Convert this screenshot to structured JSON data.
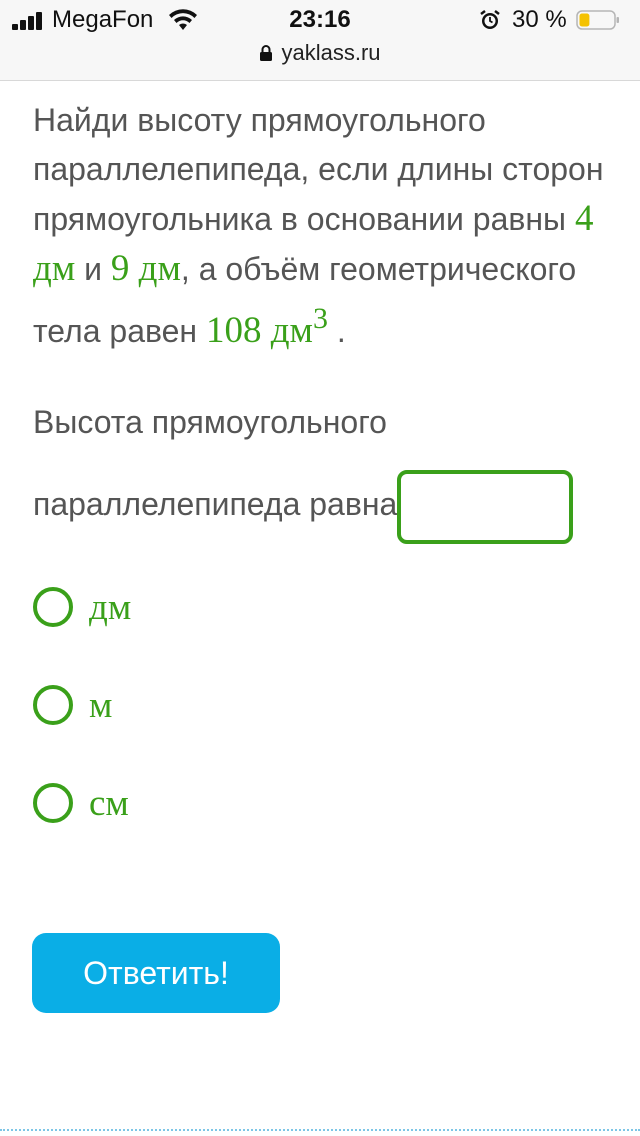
{
  "status_bar": {
    "carrier": "MegaFon",
    "time": "23:16",
    "battery_percent": "30 %",
    "battery_level": 0.3,
    "signal_icon": "signal-bars-icon",
    "wifi_icon": "wifi-icon",
    "alarm_icon": "alarm-icon",
    "battery_icon": "battery-icon"
  },
  "address_bar": {
    "url": "yaklass.ru",
    "lock_icon": "lock-icon"
  },
  "task": {
    "part1": "Найди высоту прямоугольного параллелепипеда, если длины сторон прямоугольника в основании равны ",
    "value1": "4 дм",
    "part2": " и ",
    "value2": "9 дм",
    "part3": ", а объём геометрического тела равен ",
    "value3": "108 дм",
    "value3_sup": "3",
    "part4": " ."
  },
  "answer": {
    "label_line1": "Высота прямоугольного",
    "label_line2": "параллелепипеда равна",
    "input_value": ""
  },
  "options": [
    {
      "label": "дм"
    },
    {
      "label": "м"
    },
    {
      "label": "см"
    }
  ],
  "submit_label": "Ответить!",
  "colors": {
    "accent_green": "#3aa01a",
    "button_blue": "#0aaee6",
    "text_gray": "#555555"
  }
}
